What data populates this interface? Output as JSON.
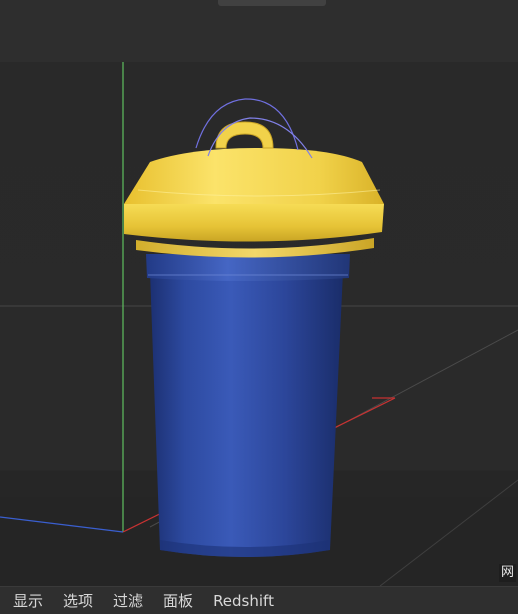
{
  "viewport": {
    "corner_label": "网",
    "colors": {
      "background": "#2a2a2a",
      "y_axis": "#5fbf5f",
      "x_axis": "#c83232",
      "z_axis": "#3a5fd0",
      "grid": "#4a4a4a",
      "lid": "#f3d64a",
      "cup": "#2f4c9e",
      "rotation_gizmo": "#6b6bdc"
    }
  },
  "menubar": {
    "items": [
      {
        "label": "显示"
      },
      {
        "label": "选项"
      },
      {
        "label": "过滤"
      },
      {
        "label": "面板"
      },
      {
        "label": "Redshift"
      }
    ]
  }
}
